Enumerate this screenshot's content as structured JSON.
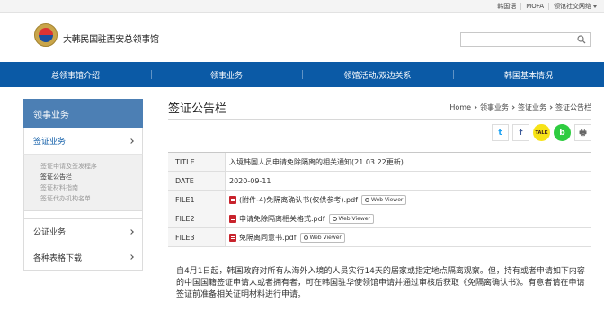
{
  "utility_links": [
    "韩国语",
    "MOFA",
    "领馆社交网络"
  ],
  "site_title": "大韩民国驻西安总领事馆",
  "search": {
    "placeholder": ""
  },
  "nav": [
    "总领事馆介绍",
    "领事业务",
    "领馆活动/双边关系",
    "韩国基本情况"
  ],
  "sidebar": {
    "header": "领事业务",
    "items": [
      {
        "label": "签证业务"
      },
      {
        "label": "公证业务"
      },
      {
        "label": "各种表格下载"
      }
    ],
    "sub_items": [
      "签证申请及签发程序",
      "签证公告栏",
      "签证材料指南",
      "签证代办机构名单"
    ]
  },
  "page": {
    "title": "签证公告栏",
    "breadcrumb": [
      "Home",
      "领事业务",
      "签证业务",
      "签证公告栏"
    ]
  },
  "social": {
    "twitter": "t",
    "facebook": "f",
    "kakao": "TALK",
    "band": "b",
    "print": "🖶"
  },
  "info": {
    "title_label": "TITLE",
    "title_value": "入境韩国人员申请免除隔离的相关通知(21.03.22更新)",
    "date_label": "DATE",
    "date_value": "2020-09-11",
    "web_viewer_label": "Web Viewer",
    "files": [
      {
        "label": "FILE1",
        "name": "(附件-4)免隔离确认书(仅供参考).pdf"
      },
      {
        "label": "FILE2",
        "name": "申请免除隔离相关格式.pdf"
      },
      {
        "label": "FILE3",
        "name": "免隔离同意书.pdf"
      }
    ]
  },
  "body_text": "自4月1日起，韩国政府对所有从海外入境的人员实行14天的居家或指定地点隔离观察。但，持有或者申请如下内容的中国国籍签证申请人或者拥有者，可在韩国驻华使领馆申请并通过审核后获取《免隔离确认书》。有意者请在申请签证前准备相关证明材料进行申请。"
}
